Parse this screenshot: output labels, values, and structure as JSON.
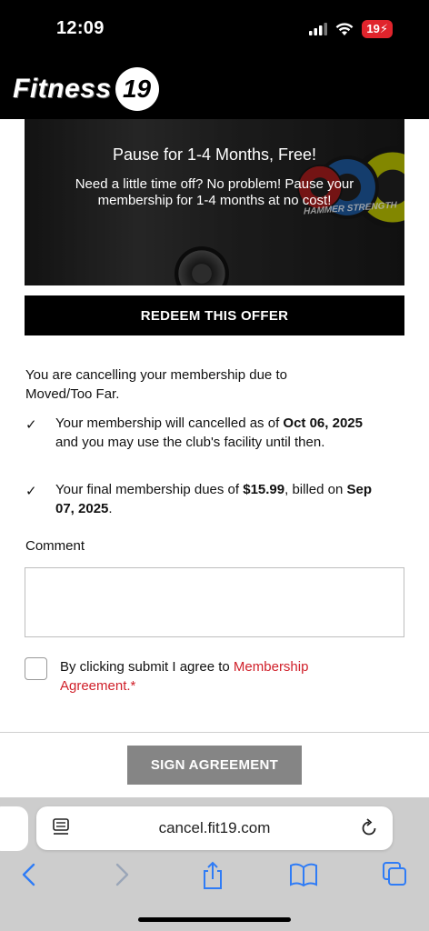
{
  "status": {
    "time": "12:09",
    "battery": "19"
  },
  "brand": {
    "name": "Fitness",
    "number": "19"
  },
  "hero": {
    "title": "Pause for 1-4 Months, Free!",
    "body": "Need a little time off? No problem! Pause your membership for 1-4 months at no cost!",
    "image_brand": "HAMMER STRENGTH"
  },
  "redeem_label": "REDEEM THIS OFFER",
  "reason": {
    "intro": "You are cancelling your membership due to",
    "value": "Moved/Too Far",
    "suffix": "."
  },
  "notes": [
    {
      "pre": "Your membership will cancelled as of ",
      "bold": "Oct 06, 2025",
      "post": " and you may use the club's facility until then."
    },
    {
      "pre": "Your final membership dues of ",
      "bold": "$15.99",
      "post": ", billed on ",
      "bold2": "Sep 07, 2025",
      "post2": "."
    }
  ],
  "comment": {
    "label": "Comment",
    "value": ""
  },
  "agreement": {
    "text": "By clicking submit I agree to ",
    "link": "Membership Agreement.*",
    "checked": false
  },
  "sign_label": "SIGN AGREEMENT",
  "browser": {
    "url": "cancel.fit19.com"
  },
  "colors": {
    "accent_red": "#d0202a",
    "ios_blue": "#2f7cf6",
    "header_black": "#000000",
    "button_gray": "#858585"
  }
}
